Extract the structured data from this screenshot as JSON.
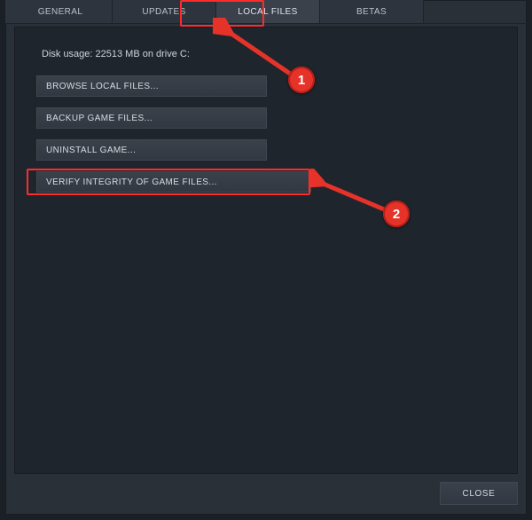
{
  "tabs": {
    "items": [
      {
        "label": "GENERAL",
        "active": false
      },
      {
        "label": "UPDATES",
        "active": false
      },
      {
        "label": "LOCAL FILES",
        "active": true
      },
      {
        "label": "BETAS",
        "active": false
      }
    ]
  },
  "content": {
    "disk_usage": "Disk usage: 22513 MB on drive C:",
    "buttons": {
      "browse": "BROWSE LOCAL FILES...",
      "backup": "BACKUP GAME FILES...",
      "uninstall": "UNINSTALL GAME...",
      "verify": "VERIFY INTEGRITY OF GAME FILES..."
    }
  },
  "footer": {
    "close": "CLOSE"
  },
  "annotations": {
    "highlight_color": "#ff2b2b",
    "callouts": [
      {
        "number": "1",
        "target": "tab-local-files"
      },
      {
        "number": "2",
        "target": "verify-integrity-button"
      }
    ]
  }
}
